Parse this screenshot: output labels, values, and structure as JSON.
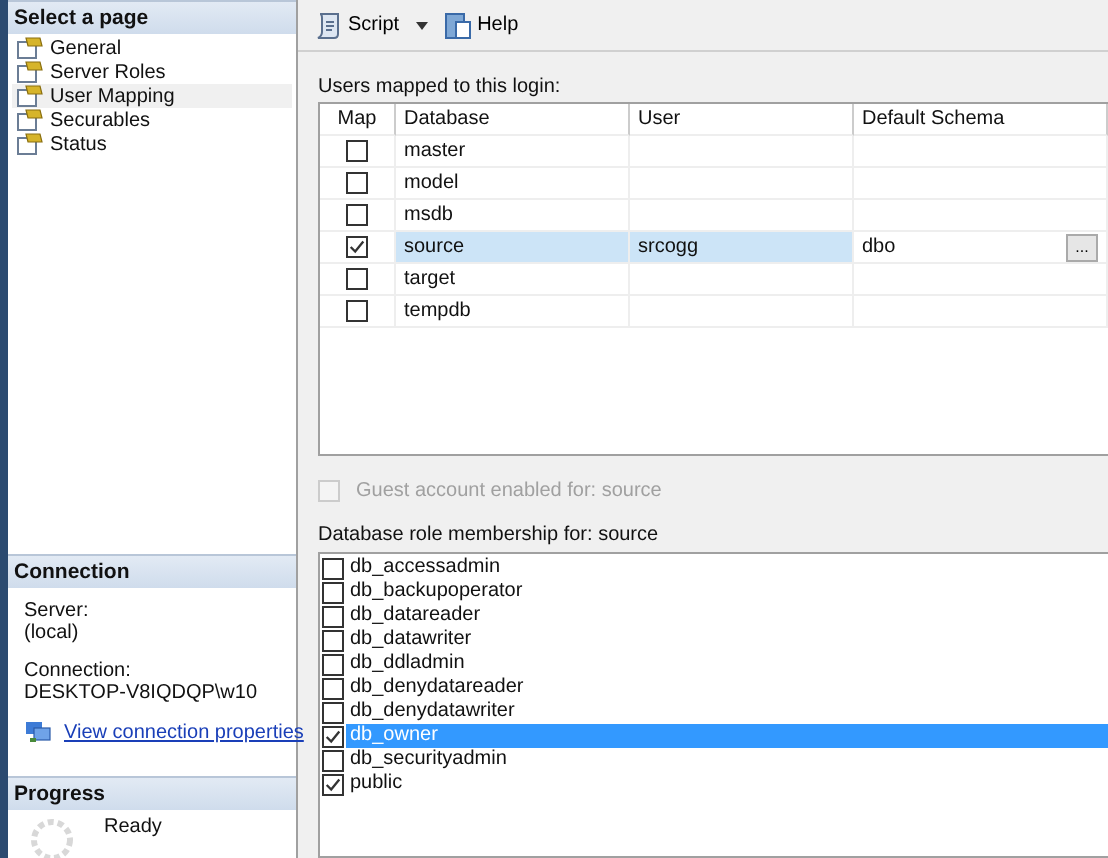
{
  "sidebar": {
    "title": "Select a page",
    "items": [
      {
        "label": "General",
        "selected": false
      },
      {
        "label": "Server Roles",
        "selected": false
      },
      {
        "label": "User Mapping",
        "selected": true
      },
      {
        "label": "Securables",
        "selected": false
      },
      {
        "label": "Status",
        "selected": false
      }
    ]
  },
  "connection": {
    "title": "Connection",
    "server_label": "Server:",
    "server": "(local)",
    "connection_label": "Connection:",
    "connection": "DESKTOP-V8IQDQP\\w10",
    "link": "View connection properties"
  },
  "progress": {
    "title": "Progress",
    "status": "Ready"
  },
  "toolbar": {
    "script": "Script",
    "help": "Help"
  },
  "users_label": "Users mapped to this login:",
  "table": {
    "columns": [
      "Map",
      "Database",
      "User",
      "Default Schema"
    ],
    "rows": [
      {
        "checked": false,
        "selected": false,
        "database": "master"
      },
      {
        "checked": false,
        "selected": false,
        "database": "model"
      },
      {
        "checked": false,
        "selected": false,
        "database": "msdb"
      },
      {
        "checked": true,
        "selected": true,
        "database": "source",
        "user": "srcogg",
        "schema": "dbo",
        "browse": "..."
      },
      {
        "checked": false,
        "selected": false,
        "database": "target"
      },
      {
        "checked": false,
        "selected": false,
        "database": "tempdb"
      }
    ]
  },
  "guest": {
    "label": "Guest account enabled for: source",
    "checked": false,
    "disabled": true
  },
  "roles_label": "Database role membership for: source",
  "roles": [
    {
      "label": "db_accessadmin",
      "checked": false,
      "selected": false
    },
    {
      "label": "db_backupoperator",
      "checked": false,
      "selected": false
    },
    {
      "label": "db_datareader",
      "checked": false,
      "selected": false
    },
    {
      "label": "db_datawriter",
      "checked": false,
      "selected": false
    },
    {
      "label": "db_ddladmin",
      "checked": false,
      "selected": false
    },
    {
      "label": "db_denydatareader",
      "checked": false,
      "selected": false
    },
    {
      "label": "db_denydatawriter",
      "checked": false,
      "selected": false
    },
    {
      "label": "db_owner",
      "checked": true,
      "selected": true
    },
    {
      "label": "db_securityadmin",
      "checked": false,
      "selected": false
    },
    {
      "label": "public",
      "checked": true,
      "selected": false
    }
  ]
}
